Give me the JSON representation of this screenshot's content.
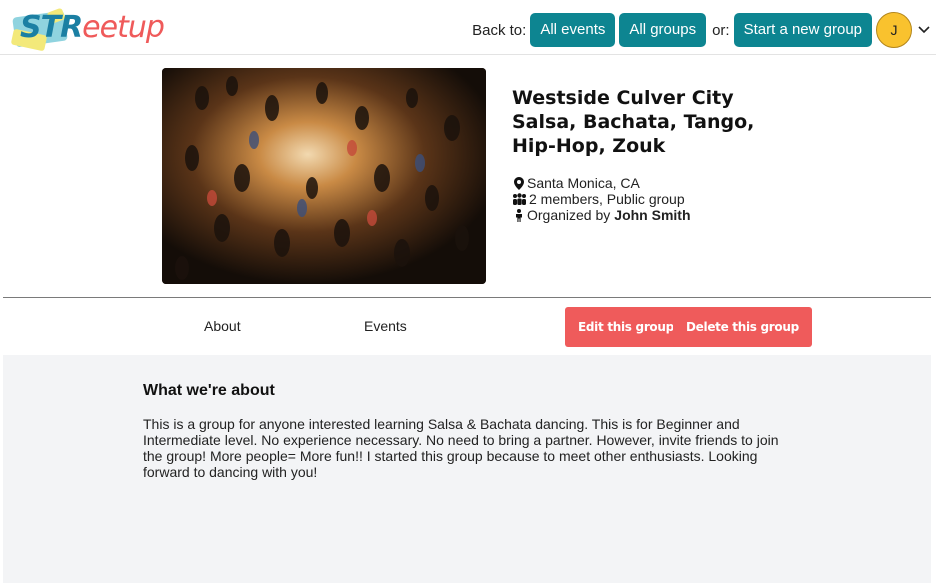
{
  "header": {
    "logo_text_a": "STR",
    "logo_text_b": "eetup",
    "back_to_label": "Back to:",
    "all_events": "All events",
    "all_groups": "All groups",
    "or_label": "or:",
    "start_group": "Start a new group",
    "avatar_initial": "J"
  },
  "group": {
    "title": "Westside Culver City Salsa, Bachata, Tango, Hip-Hop, Zouk",
    "location": "Santa Monica, CA",
    "members": "2 members, Public group",
    "organized_by_label": "Organized by",
    "organizer": "John Smith"
  },
  "tabs": {
    "about": "About",
    "events": "Events",
    "edit": "Edit this group",
    "delete": "Delete this group"
  },
  "about": {
    "heading": "What we're about",
    "body": "This is a group for anyone interested learning Salsa & Bachata dancing. This is for Beginner and Intermediate level. No experience necessary. No need to bring a partner. However, invite friends to join the group! More people= More fun!! I started this group because to meet other enthusiasts. Looking forward to dancing with you!"
  },
  "colors": {
    "teal": "#0d8591",
    "red": "#ef5b5b",
    "avatar": "#f9c22e"
  }
}
